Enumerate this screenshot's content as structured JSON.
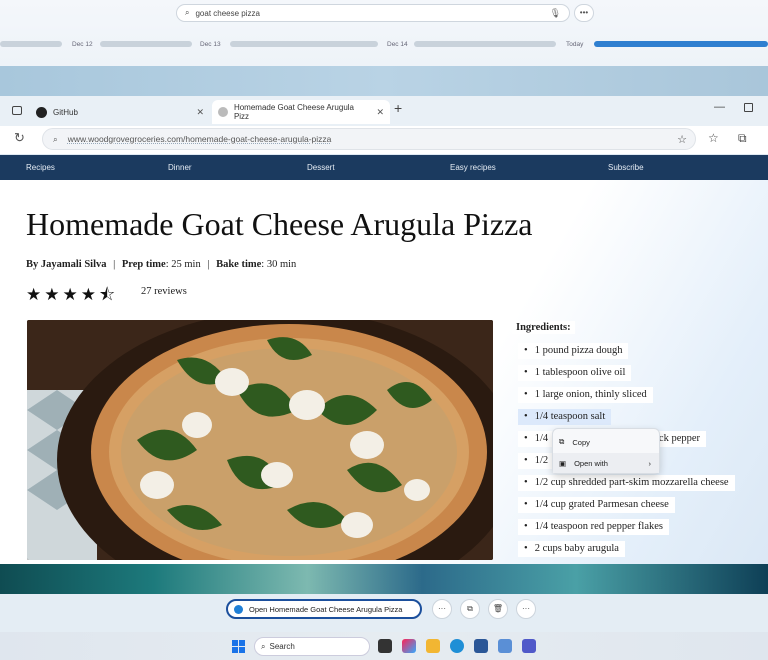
{
  "top": {
    "search_text": "goat cheese pizza",
    "timeline": [
      "Dec 12",
      "Dec 13",
      "Dec 14",
      "Today"
    ]
  },
  "browser": {
    "tabs": [
      {
        "label": "GitHub",
        "icon": "github-icon"
      },
      {
        "label": "Homemade Goat Cheese Arugula Pizz",
        "icon": "site-icon"
      }
    ],
    "url": "www.woodgrovegroceries.com/homemade-goat-cheese-arugula-pizza"
  },
  "nav": [
    "Recipes",
    "Dinner",
    "Dessert",
    "Easy recipes",
    "Subscribe"
  ],
  "recipe": {
    "title": "Homemade Goat Cheese Arugula Pizza",
    "author_label": "By Jayamali Silva",
    "sep": "|",
    "prep_label": "Prep time",
    "prep_value": ": 25 min",
    "bake_label": "Bake time",
    "bake_value": ": 30 min",
    "rating": 4.5,
    "stars": "★★★★⯪",
    "reviews": "27 reviews",
    "ingredients_heading": "Ingredients:",
    "ingredients": [
      "1 pound pizza dough",
      "1 tablespoon olive oil",
      "1 large onion, thinly sliced",
      "1/4 teaspoon salt",
      "1/4",
      "1/2",
      "1/2 cup shredded part-skim mozzarella cheese",
      "1/4 cup grated Parmesan cheese",
      "1/4 teaspoon red pepper flakes",
      "2 cups baby arugula"
    ],
    "ingredient_tail_5": "black pepper",
    "ingredient_tail_6": "e"
  },
  "context_menu": {
    "copy": "Copy",
    "open_with": "Open with",
    "chevron": "›"
  },
  "action_bar": {
    "open_label": "Open Homemade Goat Cheese Arugula Pizza",
    "more": "···"
  },
  "taskbar": {
    "search_label": "Search"
  },
  "colors": {
    "nav_bg": "#1b3a5f",
    "accent": "#1b4f9c",
    "selection": "#dce9fb"
  }
}
